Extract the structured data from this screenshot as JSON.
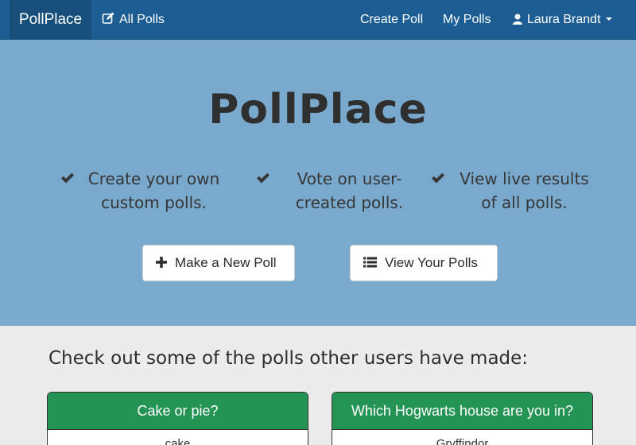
{
  "navbar": {
    "brand": "PollPlace",
    "all_polls": "All Polls",
    "create_poll": "Create Poll",
    "my_polls": "My Polls",
    "user_name": "Laura Brandt"
  },
  "hero": {
    "title": "PollPlace",
    "features": [
      "Create your own custom polls.",
      "Vote on user-created polls.",
      "View live results of all polls."
    ],
    "new_poll_button": "Make a New Poll",
    "view_polls_button": "View Your Polls"
  },
  "polls": {
    "heading": "Check out some of the polls other users have made:",
    "cards": [
      {
        "title": "Cake or pie?",
        "first_option": "cake"
      },
      {
        "title": "Which Hogwarts house are you in?",
        "first_option": "Gryffindor"
      }
    ]
  },
  "colors": {
    "navbar": "#1c5e94",
    "hero": "#79a9cd",
    "card_header": "#239454"
  }
}
